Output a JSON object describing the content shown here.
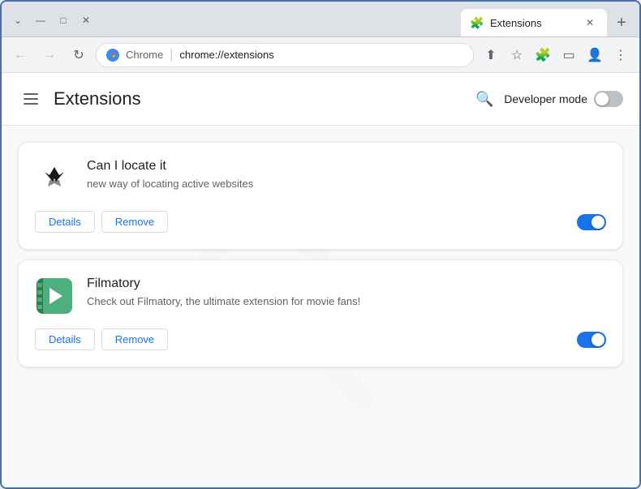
{
  "window": {
    "title": "Extensions",
    "controls": {
      "minimize": "—",
      "maximize": "□",
      "close": "✕",
      "dropdown": "⌄"
    }
  },
  "tab": {
    "favicon": "🧩",
    "title": "Extensions",
    "close": "✕"
  },
  "new_tab_btn": "+",
  "nav": {
    "back": "←",
    "forward": "→",
    "reload": "↻",
    "brand": "Chrome",
    "url": "chrome://extensions",
    "share_icon": "⬆",
    "bookmark_icon": "☆",
    "extensions_icon": "🧩",
    "sidebar_icon": "▭",
    "profile_icon": "👤",
    "menu_icon": "⋮"
  },
  "header": {
    "title": "Extensions",
    "search_icon": "🔍",
    "dev_mode_label": "Developer mode"
  },
  "extensions": [
    {
      "name": "Can I locate it",
      "description": "new way of locating active websites",
      "details_label": "Details",
      "remove_label": "Remove",
      "enabled": true
    },
    {
      "name": "Filmatory",
      "description": "Check out Filmatory, the ultimate extension for movie fans!",
      "details_label": "Details",
      "remove_label": "Remove",
      "enabled": true
    }
  ]
}
